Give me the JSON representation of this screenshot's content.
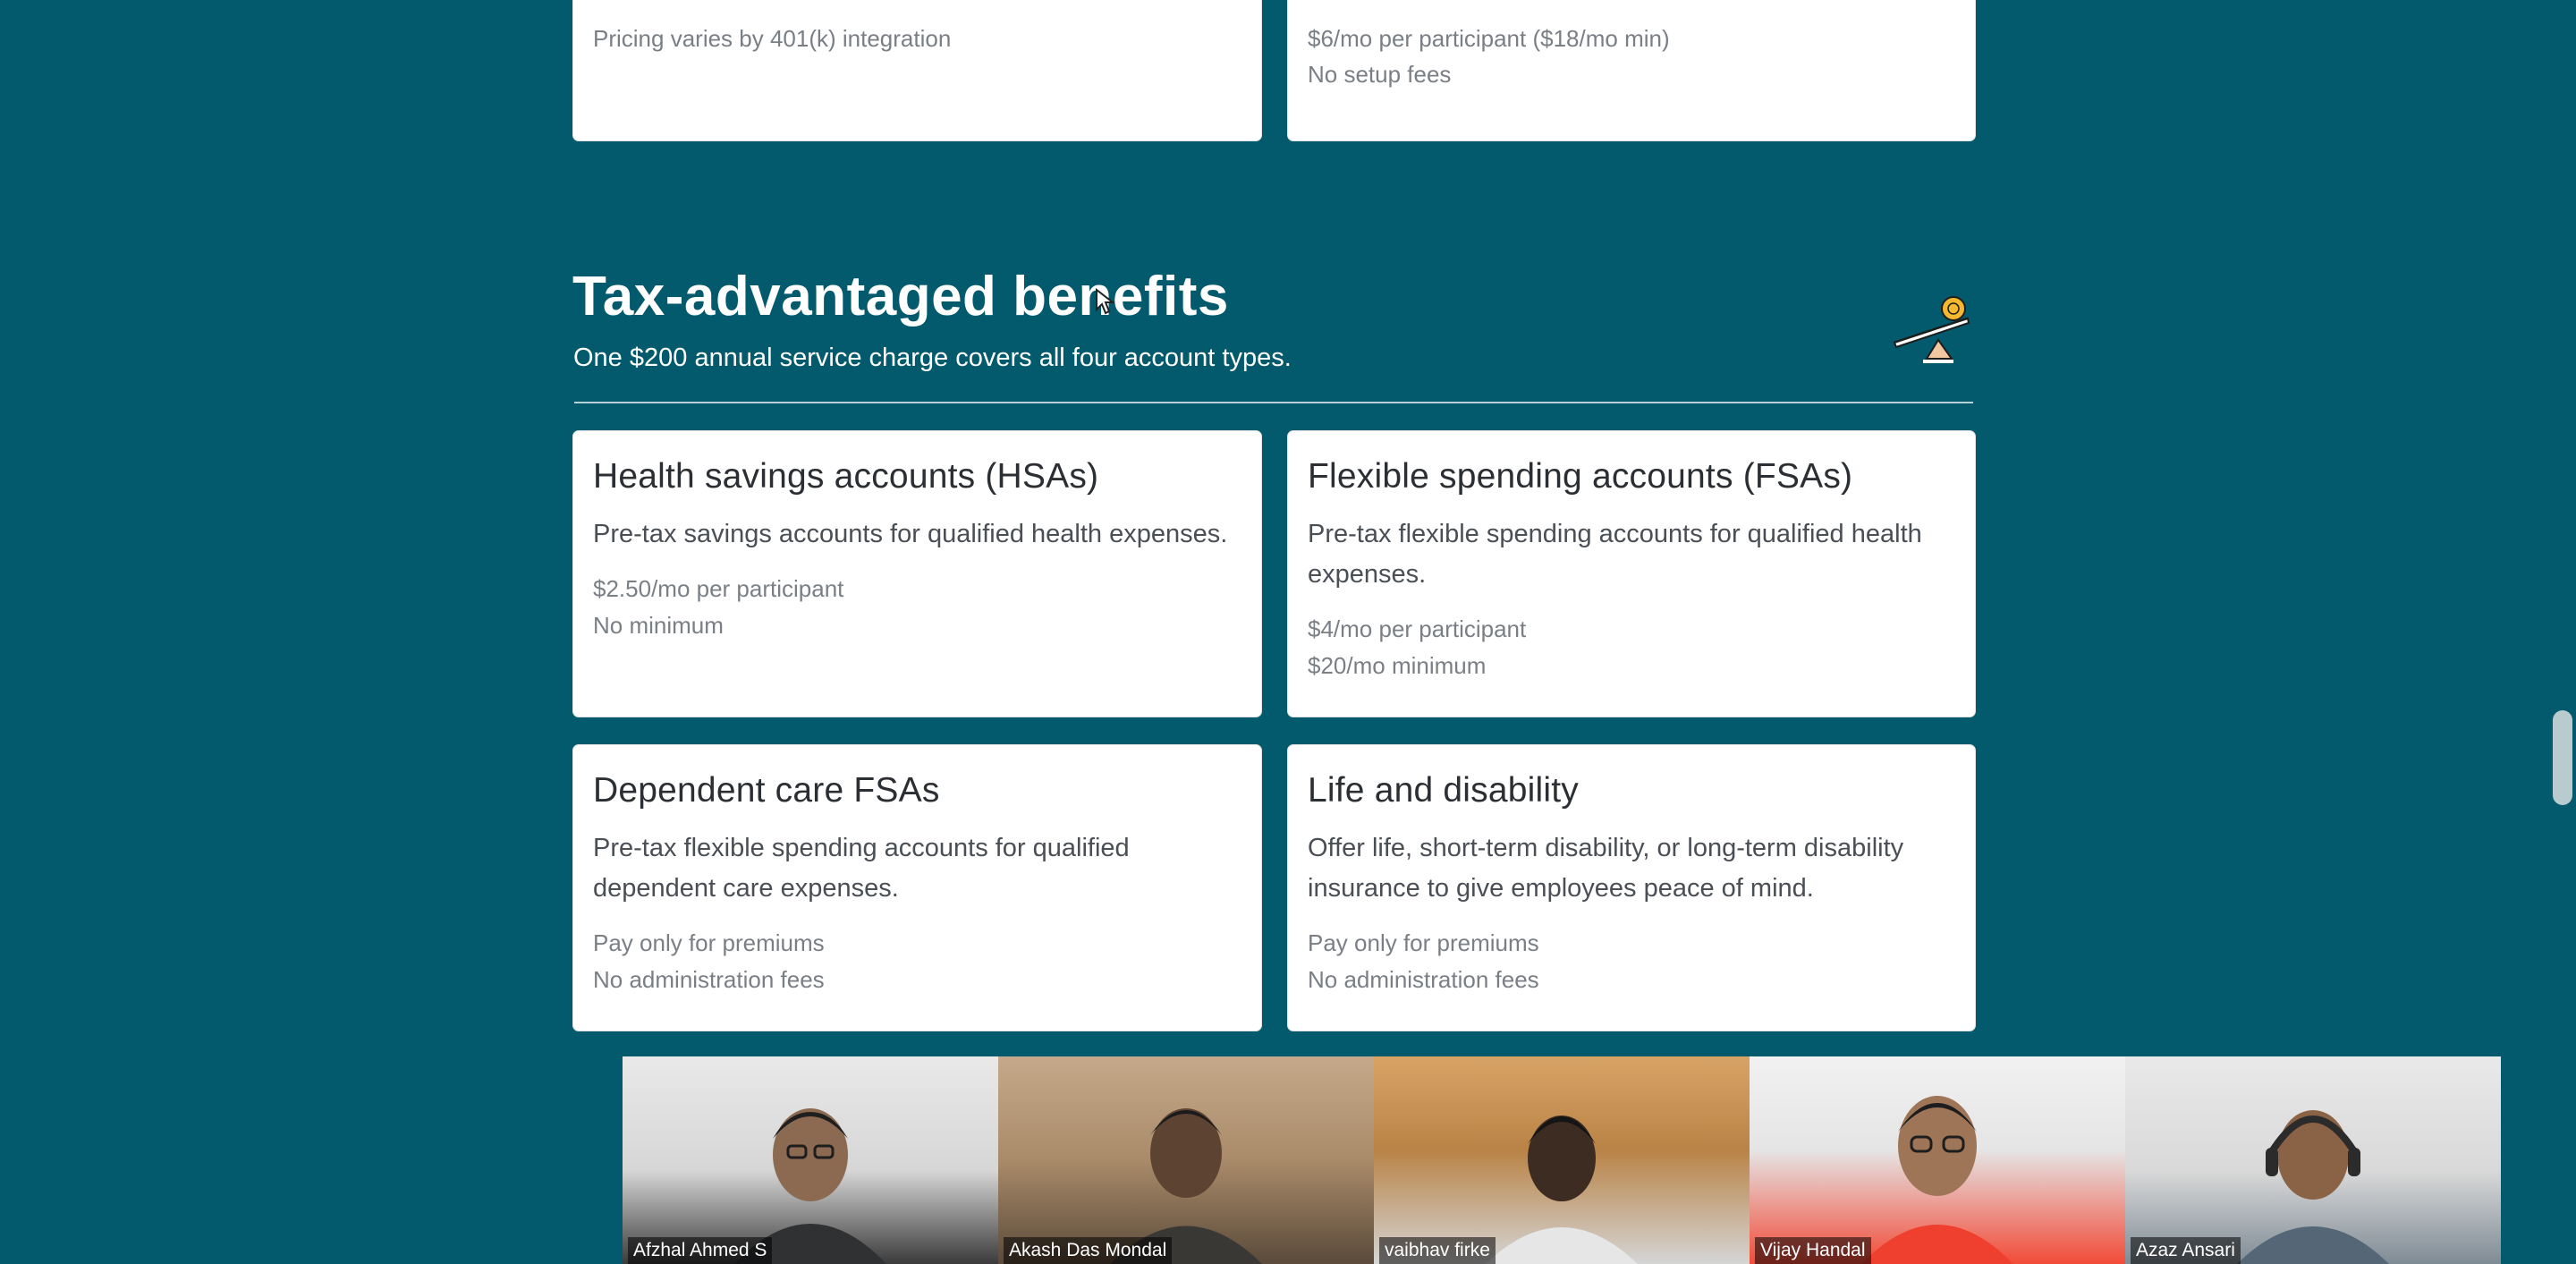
{
  "top_cards": [
    {
      "meta": [
        "Pricing varies by 401(k) integration"
      ]
    },
    {
      "meta": [
        "$6/mo per participant ($18/mo min)",
        "No setup fees"
      ]
    }
  ],
  "section": {
    "title": "Tax-advantaged benefits",
    "subtitle": "One $200 annual service charge covers all four account types.",
    "icon": "balance-scale-coin-icon"
  },
  "cards": [
    {
      "title": "Health savings accounts (HSAs)",
      "description": "Pre-tax savings accounts for qualified health expenses.",
      "price": "$2.50/mo per participant",
      "note": "No minimum"
    },
    {
      "title": "Flexible spending accounts (FSAs)",
      "description": "Pre-tax flexible spending accounts for qualified health expenses.",
      "price": "$4/mo per participant",
      "note": "$20/mo minimum"
    },
    {
      "title": "Dependent care FSAs",
      "description": "Pre-tax flexible spending accounts for qualified dependent care expenses.",
      "price": "Pay only for premiums",
      "note": "No administration fees"
    },
    {
      "title": "Life and disability",
      "description": "Offer life, short-term disability, or long-term disability insurance to give employees peace of mind.",
      "price": "Pay only for premiums",
      "note": "No administration fees"
    }
  ],
  "video_tiles": [
    {
      "name": "Afzhal Ahmed S",
      "shirt": "#2f3133",
      "skin": "#8c6a52"
    },
    {
      "name": "Akash Das Mondal",
      "shirt": "#3a3835",
      "skin": "#5d4331"
    },
    {
      "name": "vaibhav firke",
      "shirt": "#e6e6e6",
      "skin": "#3d2c22"
    },
    {
      "name": "Vijay Handal",
      "shirt": "#ef3f2f",
      "skin": "#9f7558"
    },
    {
      "name": "Azaz Ansari",
      "shirt": "#556677",
      "skin": "#8a6346"
    }
  ],
  "colors": {
    "background": "#025a6c",
    "card": "#ffffff",
    "accent": "#f5b82e"
  }
}
